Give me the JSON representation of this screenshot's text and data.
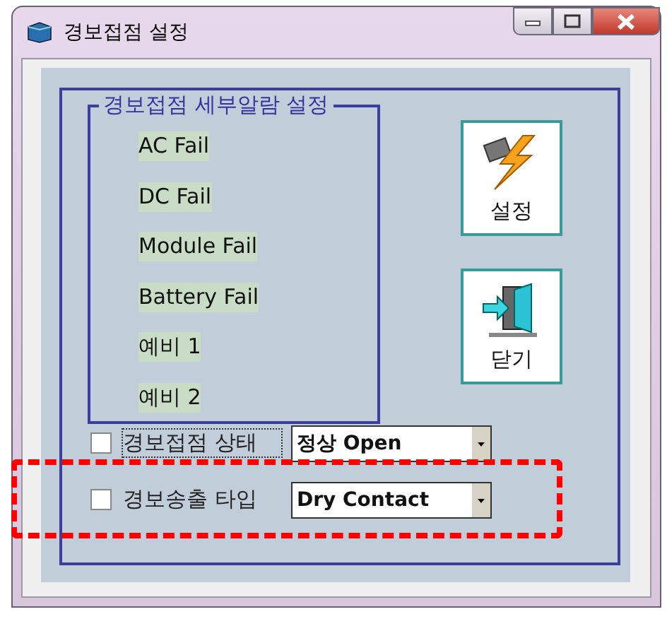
{
  "window": {
    "title": "경보접점 설정"
  },
  "alarm_group": {
    "title": "경보접점 세부알람 설정",
    "items": [
      "AC Fail",
      "DC Fail",
      "Module Fail",
      "Battery Fail",
      "예비 1",
      "예비 2"
    ]
  },
  "buttons": [
    {
      "kind": "apply",
      "label": "설정"
    },
    {
      "kind": "close",
      "label": "닫기"
    }
  ],
  "options": [
    {
      "label": "경보접점 상태",
      "checked": false,
      "focused": true,
      "value": "정상 Open",
      "highlighted": false
    },
    {
      "label": "경보송출 타입",
      "checked": false,
      "focused": false,
      "value": "Dry Contact",
      "highlighted": true
    }
  ]
}
